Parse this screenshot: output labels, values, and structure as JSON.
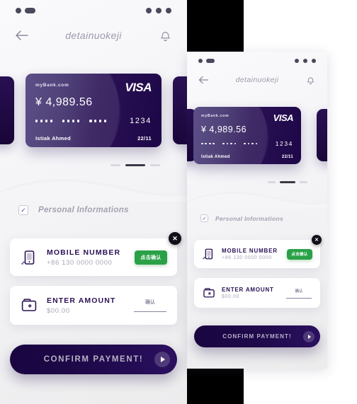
{
  "theme": {
    "accent_dark": "#2a1155",
    "accent_deep": "#190540",
    "green": "#2aa147",
    "muted_text": "#a3a3b2",
    "page_bg": "#f5f5f8",
    "black": "#000000"
  },
  "screen": {
    "statusbar": {
      "left_indicator": "signal-dots",
      "right_indicator": "menu-dots"
    },
    "header": {
      "back_icon": "arrow-left-icon",
      "title": "detainuokeji",
      "bell_icon": "bell-icon"
    },
    "card": {
      "bank": "myBank.com",
      "brand": "VISA",
      "amount": "¥ 4,989.56",
      "masked_groups": [
        "••••",
        "••••",
        "••••"
      ],
      "last4": "1234",
      "holder": "Istiak Ahmed",
      "expiry": "22/11"
    },
    "pager": {
      "count": 3,
      "active_index": 1
    },
    "section": {
      "checkbox_checked": true,
      "label": "Personal Informations"
    },
    "rows": [
      {
        "icon": "mobile-phone-icon",
        "title": "MOBILE NUMBER",
        "subtitle": "+86 130 0000 0000",
        "action_type": "green-button",
        "action_label": "点击确认"
      },
      {
        "icon": "wallet-icon",
        "title": "ENTER AMOUNT",
        "subtitle": "$00.00",
        "action_type": "underline-link",
        "action_label": "确认"
      }
    ],
    "close_button": {
      "icon": "close-icon",
      "label": "✕"
    },
    "cta": {
      "label": "CONFIRM PAYMENT!",
      "arrow_icon": "play-arrow-icon"
    }
  }
}
